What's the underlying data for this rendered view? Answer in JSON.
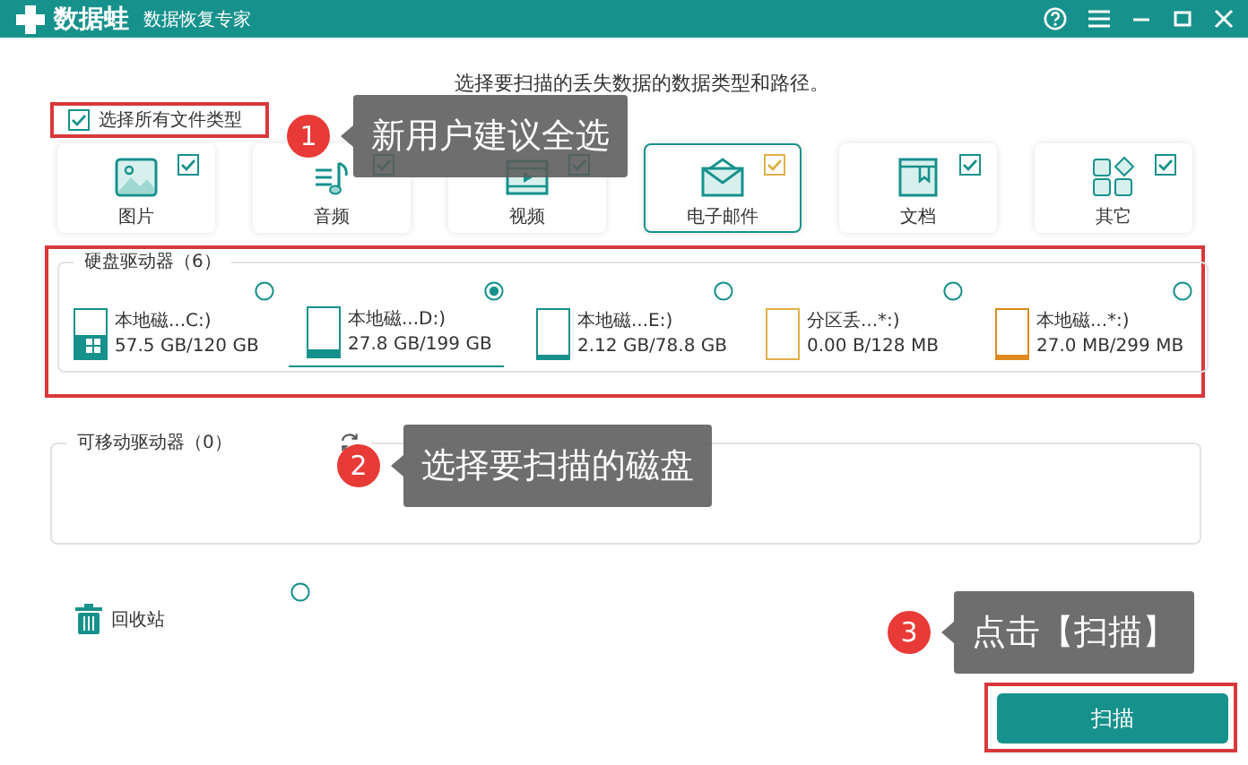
{
  "app": {
    "name": "数据蛙",
    "subtitle": "数据恢复专家"
  },
  "instruction": "选择要扫描的丢失数据的数据类型和路径。",
  "select_all": {
    "label": "选择所有文件类型",
    "checked": true
  },
  "file_types": [
    {
      "kind": "image",
      "label": "图片",
      "checked": true,
      "selected": false
    },
    {
      "kind": "audio",
      "label": "音频",
      "checked": true,
      "selected": false
    },
    {
      "kind": "video",
      "label": "视频",
      "checked": true,
      "selected": false
    },
    {
      "kind": "email",
      "label": "电子邮件",
      "checked": true,
      "selected": true
    },
    {
      "kind": "document",
      "label": "文档",
      "checked": true,
      "selected": false
    },
    {
      "kind": "other",
      "label": "其它",
      "checked": true,
      "selected": false
    }
  ],
  "hard_drives": {
    "title": "硬盘驱动器（6）",
    "drives": [
      {
        "kind": "system",
        "name": "本地磁...C:)",
        "usage": "57.5 GB/120 GB",
        "level": 0.48,
        "color": "#17918c",
        "selected": false
      },
      {
        "kind": "disk",
        "name": "本地磁...D:)",
        "usage": "27.8 GB/199 GB",
        "level": 0.14,
        "color": "#17918c",
        "selected": true
      },
      {
        "kind": "disk",
        "name": "本地磁...E:)",
        "usage": "2.12 GB/78.8 GB",
        "level": 0.03,
        "color": "#17918c",
        "selected": false
      },
      {
        "kind": "disk",
        "name": "分区丢...*:)",
        "usage": "0.00  B/128 MB",
        "level": 0,
        "color": "#e0b04a",
        "selected": false
      },
      {
        "kind": "disk",
        "name": "本地磁...*:)",
        "usage": "27.0 MB/299 MB",
        "level": 0.09,
        "color": "#de8a1e",
        "selected": false
      }
    ]
  },
  "removable_drives": {
    "title": "可移动驱动器（0）"
  },
  "recycle_bin": {
    "label": "回收站",
    "selected": false
  },
  "scan_button": "扫描",
  "callouts": [
    {
      "number": "1",
      "text": "新用户建议全选"
    },
    {
      "number": "2",
      "text": "选择要扫描的磁盘"
    },
    {
      "number": "3",
      "text": "点击【扫描】"
    }
  ]
}
